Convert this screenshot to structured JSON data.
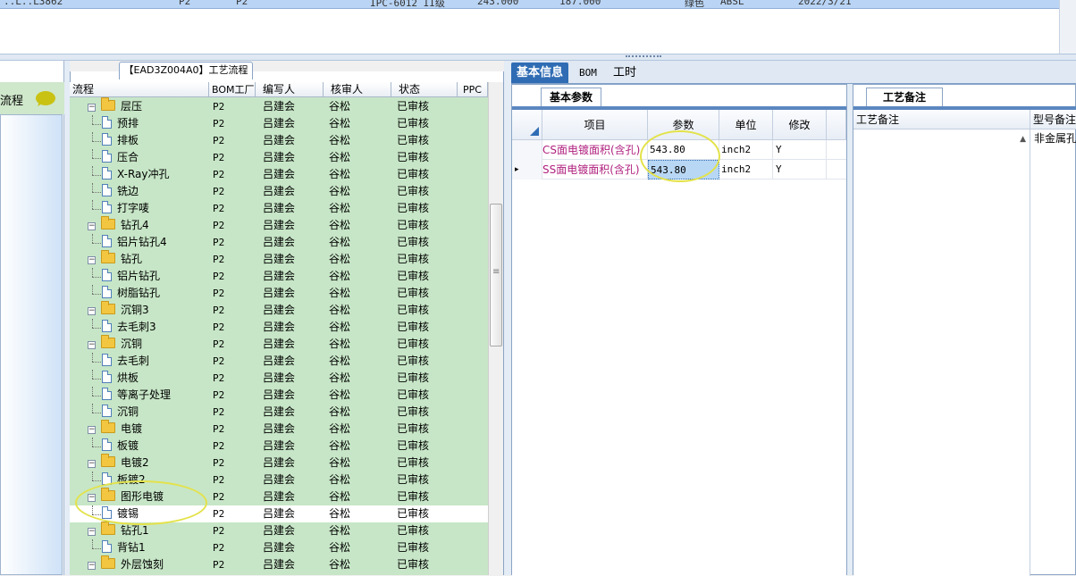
{
  "top_row": {
    "cells": [
      "..L..L3862",
      "P2",
      "P2",
      "IPC-6012 II级",
      "243.000",
      "187.000",
      "绿色",
      "ABSL",
      "2022/3/21"
    ]
  },
  "left_nav": {
    "title": "流程"
  },
  "process_panel": {
    "title": "【EAD3Z004A0】工艺流程",
    "columns": [
      "流程",
      "BOM工厂",
      "编写人",
      "核审人",
      "状态",
      "PPC"
    ],
    "rows": [
      {
        "name": "层压",
        "kind": "folder",
        "level": 0,
        "factory": "P2",
        "writer": "吕建会",
        "reviewer": "谷松",
        "status": "已审核"
      },
      {
        "name": "预排",
        "kind": "doc",
        "level": 1,
        "factory": "P2",
        "writer": "吕建会",
        "reviewer": "谷松",
        "status": "已审核"
      },
      {
        "name": "排板",
        "kind": "doc",
        "level": 1,
        "factory": "P2",
        "writer": "吕建会",
        "reviewer": "谷松",
        "status": "已审核"
      },
      {
        "name": "压合",
        "kind": "doc",
        "level": 1,
        "factory": "P2",
        "writer": "吕建会",
        "reviewer": "谷松",
        "status": "已审核"
      },
      {
        "name": "X-Ray冲孔",
        "kind": "doc",
        "level": 1,
        "factory": "P2",
        "writer": "吕建会",
        "reviewer": "谷松",
        "status": "已审核"
      },
      {
        "name": "铣边",
        "kind": "doc",
        "level": 1,
        "factory": "P2",
        "writer": "吕建会",
        "reviewer": "谷松",
        "status": "已审核"
      },
      {
        "name": "打字唛",
        "kind": "doc",
        "level": 1,
        "factory": "P2",
        "writer": "吕建会",
        "reviewer": "谷松",
        "status": "已审核"
      },
      {
        "name": "钻孔4",
        "kind": "folder",
        "level": 0,
        "factory": "P2",
        "writer": "吕建会",
        "reviewer": "谷松",
        "status": "已审核"
      },
      {
        "name": "铝片钻孔4",
        "kind": "doc",
        "level": 1,
        "factory": "P2",
        "writer": "吕建会",
        "reviewer": "谷松",
        "status": "已审核"
      },
      {
        "name": "钻孔",
        "kind": "folder",
        "level": 0,
        "factory": "P2",
        "writer": "吕建会",
        "reviewer": "谷松",
        "status": "已审核"
      },
      {
        "name": "铝片钻孔",
        "kind": "doc",
        "level": 1,
        "factory": "P2",
        "writer": "吕建会",
        "reviewer": "谷松",
        "status": "已审核"
      },
      {
        "name": "树脂钻孔",
        "kind": "doc",
        "level": 1,
        "factory": "P2",
        "writer": "吕建会",
        "reviewer": "谷松",
        "status": "已审核"
      },
      {
        "name": "沉铜3",
        "kind": "folder",
        "level": 0,
        "factory": "P2",
        "writer": "吕建会",
        "reviewer": "谷松",
        "status": "已审核"
      },
      {
        "name": "去毛刺3",
        "kind": "doc",
        "level": 1,
        "factory": "P2",
        "writer": "吕建会",
        "reviewer": "谷松",
        "status": "已审核"
      },
      {
        "name": "沉铜",
        "kind": "folder",
        "level": 0,
        "factory": "P2",
        "writer": "吕建会",
        "reviewer": "谷松",
        "status": "已审核"
      },
      {
        "name": "去毛刺",
        "kind": "doc",
        "level": 1,
        "factory": "P2",
        "writer": "吕建会",
        "reviewer": "谷松",
        "status": "已审核"
      },
      {
        "name": "烘板",
        "kind": "doc",
        "level": 1,
        "factory": "P2",
        "writer": "吕建会",
        "reviewer": "谷松",
        "status": "已审核"
      },
      {
        "name": "等离子处理",
        "kind": "doc",
        "level": 1,
        "factory": "P2",
        "writer": "吕建会",
        "reviewer": "谷松",
        "status": "已审核"
      },
      {
        "name": "沉铜",
        "kind": "doc",
        "level": 1,
        "factory": "P2",
        "writer": "吕建会",
        "reviewer": "谷松",
        "status": "已审核"
      },
      {
        "name": "电镀",
        "kind": "folder",
        "level": 0,
        "factory": "P2",
        "writer": "吕建会",
        "reviewer": "谷松",
        "status": "已审核"
      },
      {
        "name": "板镀",
        "kind": "doc",
        "level": 1,
        "factory": "P2",
        "writer": "吕建会",
        "reviewer": "谷松",
        "status": "已审核"
      },
      {
        "name": "电镀2",
        "kind": "folder",
        "level": 0,
        "factory": "P2",
        "writer": "吕建会",
        "reviewer": "谷松",
        "status": "已审核"
      },
      {
        "name": "板镀2",
        "kind": "doc",
        "level": 1,
        "factory": "P2",
        "writer": "吕建会",
        "reviewer": "谷松",
        "status": "已审核"
      },
      {
        "name": "图形电镀",
        "kind": "folder",
        "level": 0,
        "factory": "P2",
        "writer": "吕建会",
        "reviewer": "谷松",
        "status": "已审核"
      },
      {
        "name": "镀锡",
        "kind": "doc",
        "level": 1,
        "factory": "P2",
        "writer": "吕建会",
        "reviewer": "谷松",
        "status": "已审核",
        "selected": true
      },
      {
        "name": "钻孔1",
        "kind": "folder",
        "level": 0,
        "factory": "P2",
        "writer": "吕建会",
        "reviewer": "谷松",
        "status": "已审核"
      },
      {
        "name": "背钻1",
        "kind": "doc",
        "level": 1,
        "factory": "P2",
        "writer": "吕建会",
        "reviewer": "谷松",
        "status": "已审核"
      },
      {
        "name": "外层蚀刻",
        "kind": "folder",
        "level": 0,
        "factory": "P2",
        "writer": "吕建会",
        "reviewer": "谷松",
        "status": "已审核"
      }
    ]
  },
  "right_tabs": [
    "基本信息",
    "BOM",
    "工时"
  ],
  "params_panel": {
    "tab_label": "基本参数",
    "columns": [
      "项目",
      "参数",
      "单位",
      "修改"
    ],
    "rows": [
      {
        "indicator": "",
        "item": "CS面电镀面积(含孔)",
        "value": "543.80",
        "unit": "inch2",
        "modified": "Y"
      },
      {
        "indicator": "▸",
        "item": "SS面电镀面积(含孔)",
        "value": "543.80",
        "unit": "inch2",
        "modified": "Y",
        "selected": true
      }
    ]
  },
  "notes_panel": {
    "tab_label": "工艺备注",
    "columns": [
      "工艺备注",
      "型号备注"
    ],
    "model_note": "非金属孔"
  },
  "colors": {
    "grid_green": "#c7e6c7",
    "active_tab": "#2f6cb4",
    "item_text": "#b0207e",
    "annotation_circle": "#e3e24a"
  }
}
